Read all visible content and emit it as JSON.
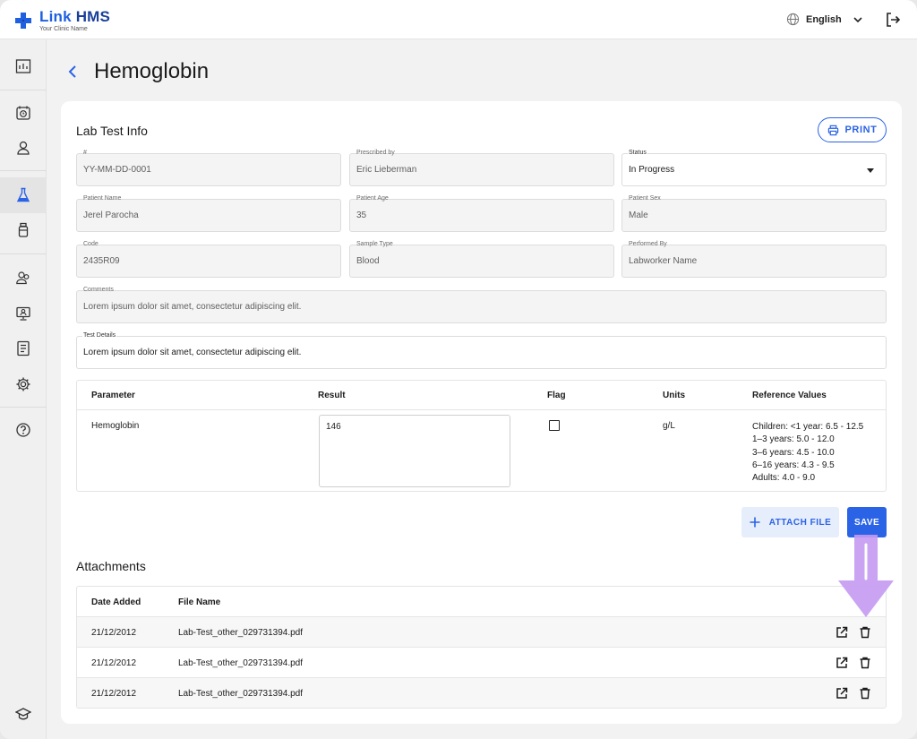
{
  "app": {
    "brand_link": "Link",
    "brand_hms": "HMS",
    "clinic_name": "Your Clinic Name",
    "language": "English",
    "accent_color": "#2b63e6"
  },
  "sidebar": {
    "items": [
      {
        "icon": "dashboard-icon"
      },
      {
        "icon": "calendar-clock-icon"
      },
      {
        "icon": "patient-icon"
      },
      {
        "icon": "lab-flask-icon",
        "active": true
      },
      {
        "icon": "medicine-bottle-icon"
      },
      {
        "icon": "staff-group-icon"
      },
      {
        "icon": "monitor-user-icon"
      },
      {
        "icon": "report-document-icon"
      },
      {
        "icon": "settings-gear-icon"
      },
      {
        "icon": "help-icon"
      },
      {
        "icon": "graduation-cap-icon"
      }
    ]
  },
  "page": {
    "title": "Hemoglobin"
  },
  "lab_info": {
    "heading": "Lab Test Info",
    "print_label": "PRINT",
    "fields": {
      "number": {
        "label": "#",
        "value": "YY-MM-DD-0001"
      },
      "prescribed_by": {
        "label": "Prescribed by",
        "value": "Eric Lieberman"
      },
      "status": {
        "label": "Status",
        "value": "In Progress"
      },
      "patient_name": {
        "label": "Patient Name",
        "value": "Jerel Parocha"
      },
      "patient_age": {
        "label": "Patient Age",
        "value": "35"
      },
      "patient_sex": {
        "label": "Patient Sex",
        "value": "Male"
      },
      "code": {
        "label": "Code",
        "value": "2435R09"
      },
      "sample_type": {
        "label": "Sample Type",
        "value": "Blood"
      },
      "performed_by": {
        "label": "Performed By",
        "value": "Labworker Name"
      },
      "comments": {
        "label": "Comments",
        "value": "Lorem ipsum dolor sit amet, consectetur adipiscing elit."
      },
      "test_details": {
        "label": "Test Details",
        "value": "Lorem ipsum dolor sit amet, consectetur adipiscing elit."
      }
    }
  },
  "params_table": {
    "headers": [
      "Parameter",
      "Result",
      "Flag",
      "Units",
      "Reference Values"
    ],
    "row": {
      "parameter": "Hemoglobin",
      "result": "146",
      "flag": false,
      "units": "g/L",
      "reference": [
        "Children: <1 year: 6.5 - 12.5",
        "1–3 years: 5.0 - 12.0",
        "3–6 years: 4.5 - 10.0",
        "6–16 years: 4.3 - 9.5",
        "Adults: 4.0 - 9.0"
      ]
    }
  },
  "actions": {
    "attach_label": "ATTACH FILE",
    "save_label": "SAVE"
  },
  "attachments": {
    "heading": "Attachments",
    "headers": [
      "Date Added",
      "File Name"
    ],
    "rows": [
      {
        "date": "21/12/2012",
        "file": "Lab-Test_other_029731394.pdf"
      },
      {
        "date": "21/12/2012",
        "file": "Lab-Test_other_029731394.pdf"
      },
      {
        "date": "21/12/2012",
        "file": "Lab-Test_other_029731394.pdf"
      }
    ]
  }
}
